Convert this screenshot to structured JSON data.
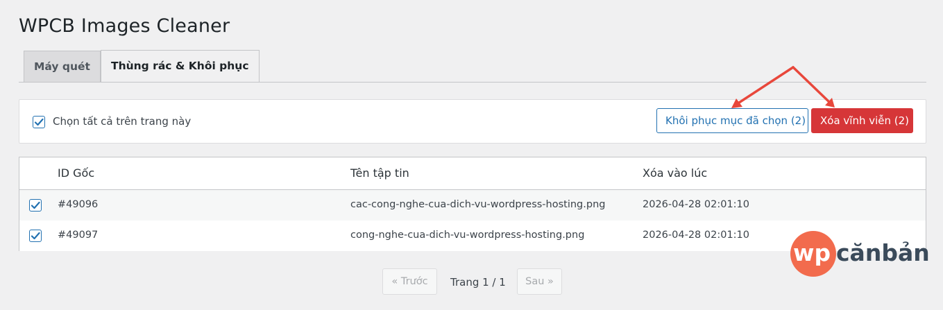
{
  "page": {
    "title": "WPCB Images Cleaner"
  },
  "tabs": [
    {
      "label": "Máy quét",
      "active": false
    },
    {
      "label": "Thùng rác & Khôi phục",
      "active": true
    }
  ],
  "bulk": {
    "select_all_label": "Chọn tất cả trên trang này",
    "select_all_checked": true,
    "restore_label": "Khôi phục mục đã chọn (2)",
    "delete_label": "Xóa vĩnh viễn (2)"
  },
  "table": {
    "headers": [
      "ID Gốc",
      "Tên tập tin",
      "Xóa vào lúc"
    ],
    "rows": [
      {
        "checked": true,
        "id": "#49096",
        "file": "cac-cong-nghe-cua-dich-vu-wordpress-hosting.png",
        "deleted_at": "2026-04-28 02:01:10"
      },
      {
        "checked": true,
        "id": "#49097",
        "file": "cong-nghe-cua-dich-vu-wordpress-hosting.png",
        "deleted_at": "2026-04-28 02:01:10"
      }
    ]
  },
  "pagination": {
    "prev_label": "« Trước",
    "page_info": "Trang 1 / 1",
    "next_label": "Sau »"
  },
  "logo": {
    "wp": "wp",
    "text": "cănbản"
  },
  "colors": {
    "accent": "#2271b1",
    "danger": "#d63638",
    "annotation": "#e8473b",
    "logo": "#f26b4d"
  },
  "icons": {
    "checkbox": "checkmark-icon",
    "annotation": "arrow-icon"
  }
}
